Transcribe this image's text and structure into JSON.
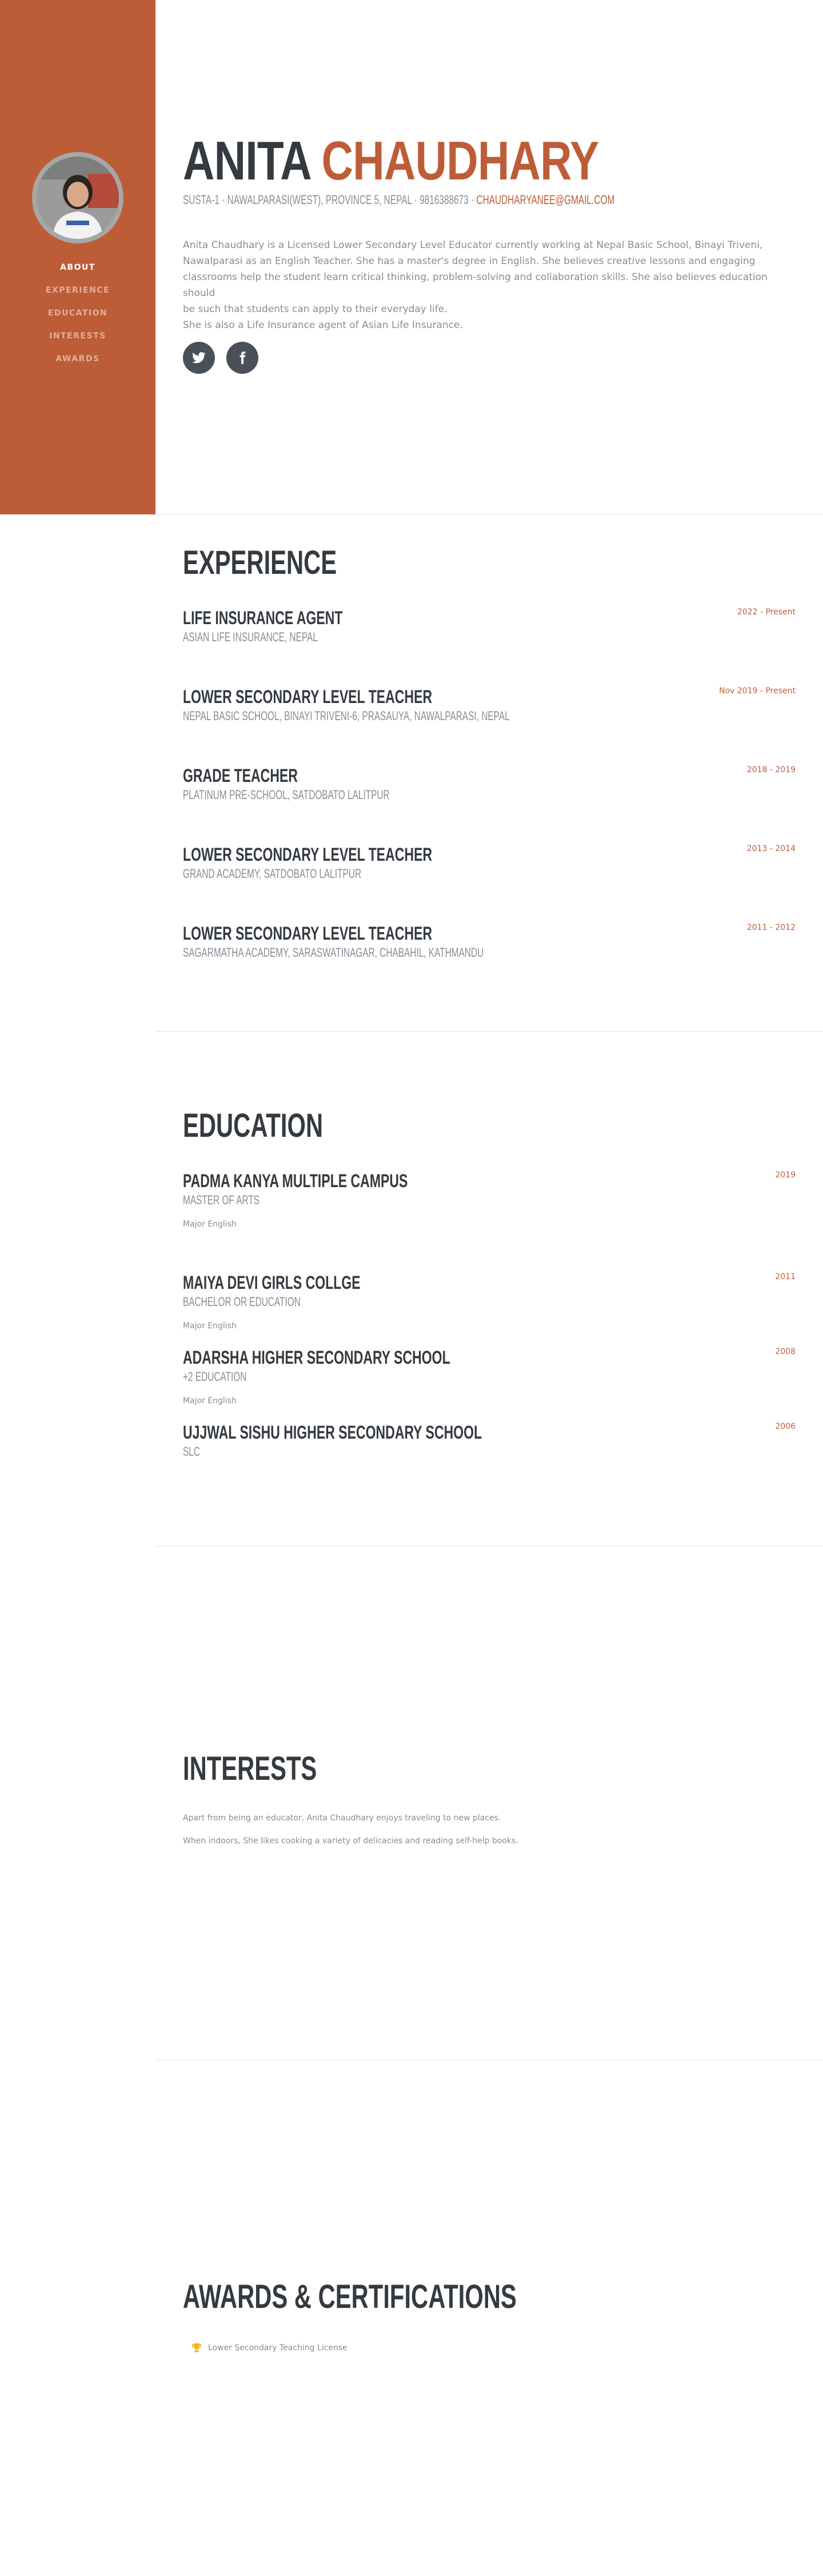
{
  "nav": {
    "about": "About",
    "experience": "Experience",
    "education": "Education",
    "interests": "Interests",
    "awards": "Awards",
    "active": "about"
  },
  "about": {
    "first_name": "Anita",
    "last_name": "Chaudhary",
    "address_line": "Susta-1 · Nawalparasi(West), Province 5, Nepal · 9816388673 · ",
    "email": "chaudharyanee@gmail.com",
    "bio_lines": [
      "Anita Chaudhary is a Licensed Lower Secondary Level Educator currently working at Nepal Basic School, Binayi Triveni,",
      "Nawalparasi as an English Teacher. She has a master's degree in English. She believes creative lessons and engaging",
      "classrooms help the student learn critical thinking, problem-solving and collaboration skills. She also believes education should",
      "be such that students can apply to their everyday life.",
      "She is also a Life Insurance agent of Asian Life Insurance."
    ],
    "social": [
      {
        "icon": "twitter-icon"
      },
      {
        "icon": "facebook-icon"
      }
    ]
  },
  "experience": {
    "title": "Experience",
    "items": [
      {
        "title": "Life Insurance Agent",
        "subtitle": "Asian Life Insurance, Nepal",
        "date": "2022 - Present"
      },
      {
        "title": "Lower Secondary Level Teacher",
        "subtitle": "Nepal Basic School, Binayi Triveni-6, Prasauya, Nawalparasi, Nepal",
        "date": "Nov 2019 - Present"
      },
      {
        "title": "Grade Teacher",
        "subtitle": "Platinum Pre-School, Satdobato Lalitpur",
        "date": "2018 - 2019"
      },
      {
        "title": "Lower Secondary Level Teacher",
        "subtitle": "Grand Academy, Satdobato Lalitpur",
        "date": "2013 - 2014"
      },
      {
        "title": "Lower Secondary Level Teacher",
        "subtitle": "Sagarmatha Academy, Saraswatinagar, Chabahil, Kathmandu",
        "date": "2011 - 2012"
      }
    ]
  },
  "education": {
    "title": "Education",
    "items": [
      {
        "title": "Padma Kanya Multiple Campus",
        "subtitle": "Master of Arts",
        "note": "Major English",
        "date": "2019"
      },
      {
        "title": "Maiya Devi Girls Collge",
        "subtitle": "Bachelor or Education",
        "note": "Major English",
        "date": "2011"
      },
      {
        "title": "Adarsha Higher Secondary School",
        "subtitle": "+2 Education",
        "note": "Major English",
        "date": "2008"
      },
      {
        "title": "Ujjwal Sishu Higher Secondary School",
        "subtitle": "SLC",
        "note": "",
        "date": "2006"
      }
    ]
  },
  "interests": {
    "title": "Interests",
    "paragraphs": [
      "Apart from being an educator, Anita Chaudhary enjoys traveling to new places.",
      "When indoors, She likes cooking a variety of delicacies and reading self-help books."
    ]
  },
  "awards": {
    "title": "Awards & Certifications",
    "items": [
      {
        "icon": "trophy-icon",
        "label": "Lower Secondary Teaching License"
      }
    ]
  },
  "colors": {
    "primary": "#bd5d38",
    "heading": "#343a40",
    "muted": "#868e96",
    "social_bg": "#495057"
  }
}
